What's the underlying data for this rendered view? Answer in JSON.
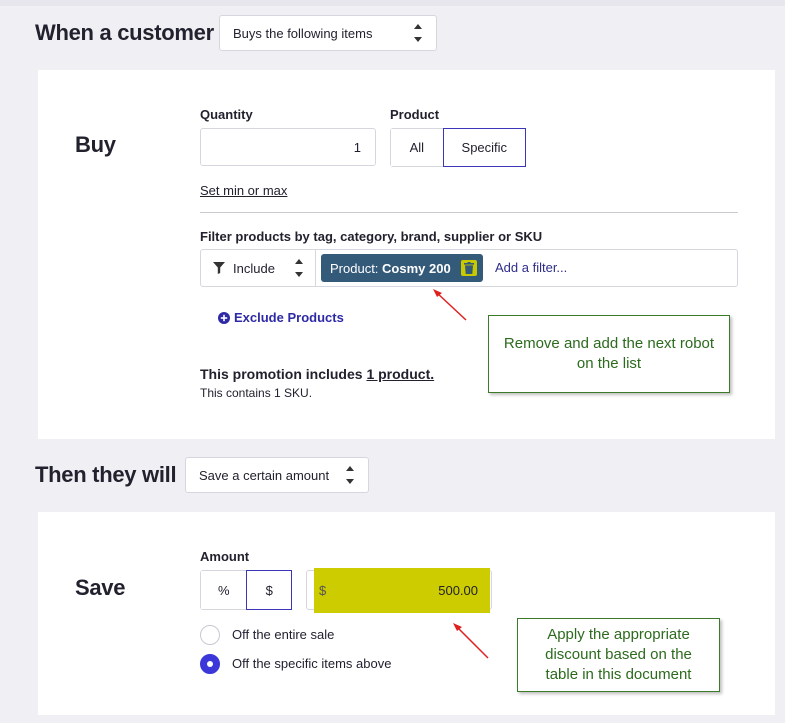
{
  "trigger": {
    "heading": "When a customer",
    "select_value": "Buys the following items"
  },
  "buy": {
    "title": "Buy",
    "quantity_label": "Quantity",
    "quantity_value": "1",
    "product_label": "Product",
    "product_options": [
      "All",
      "Specific"
    ],
    "product_selected": "Specific",
    "min_max_link": "Set min or max",
    "filter_label": "Filter products by tag, category, brand, supplier or SKU",
    "filter_mode": "Include",
    "chip_prefix": "Product: ",
    "chip_value": "Cosmy 200",
    "filter_placeholder": "Add a filter...",
    "exclude_link": "Exclude Products",
    "summary_prefix": "This promotion includes ",
    "summary_link": "1 product.",
    "summary_sub": "This contains 1 SKU."
  },
  "action": {
    "heading": "Then they will",
    "select_value": "Save a certain amount"
  },
  "save": {
    "title": "Save",
    "amount_label": "Amount",
    "unit_options": [
      "%",
      "$"
    ],
    "unit_selected": "$",
    "currency_symbol": "$",
    "amount_value": "500.00",
    "radio_options": [
      {
        "label": "Off the entire sale",
        "checked": false
      },
      {
        "label": "Off the specific items above",
        "checked": true
      }
    ]
  },
  "annotations": {
    "note_1": "Remove and add the next robot on the list",
    "note_2": "Apply the appropriate discount based on the table in this document"
  },
  "colors": {
    "accent": "#3b37d8",
    "chip": "#345a7a",
    "highlight": "#cccc00",
    "note_border": "#3a7a2a",
    "arrow": "#e02020"
  }
}
